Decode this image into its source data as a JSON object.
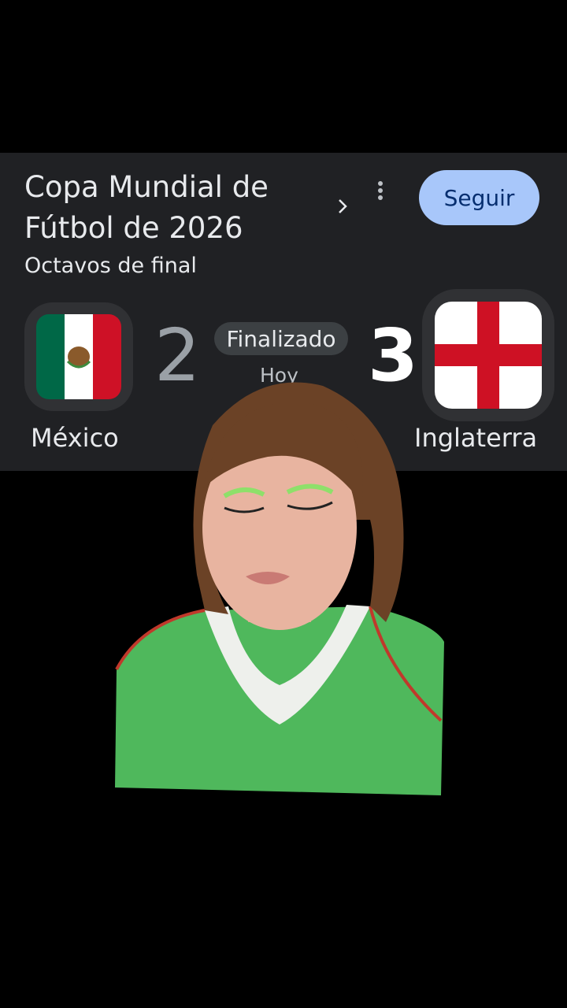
{
  "match_card": {
    "title_line1": "Copa Mundial de",
    "title_line2": "Fútbol de 2026",
    "follow_label": "Seguir",
    "round": "Octavos de final",
    "status": "Finalizado",
    "date": "Hoy",
    "home": {
      "name": "México",
      "score": "2"
    },
    "away": {
      "name": "Inglaterra",
      "score": "3"
    }
  },
  "icons": {
    "chevron": "chevron-right-icon",
    "more": "more-vert-icon"
  },
  "colors": {
    "card_bg": "#202124",
    "follow_bg": "#a8c7fa",
    "mexico_green": "#006847",
    "mexico_red": "#ce1126",
    "england_red": "#ce1124",
    "jersey_green": "#4fb85c"
  }
}
